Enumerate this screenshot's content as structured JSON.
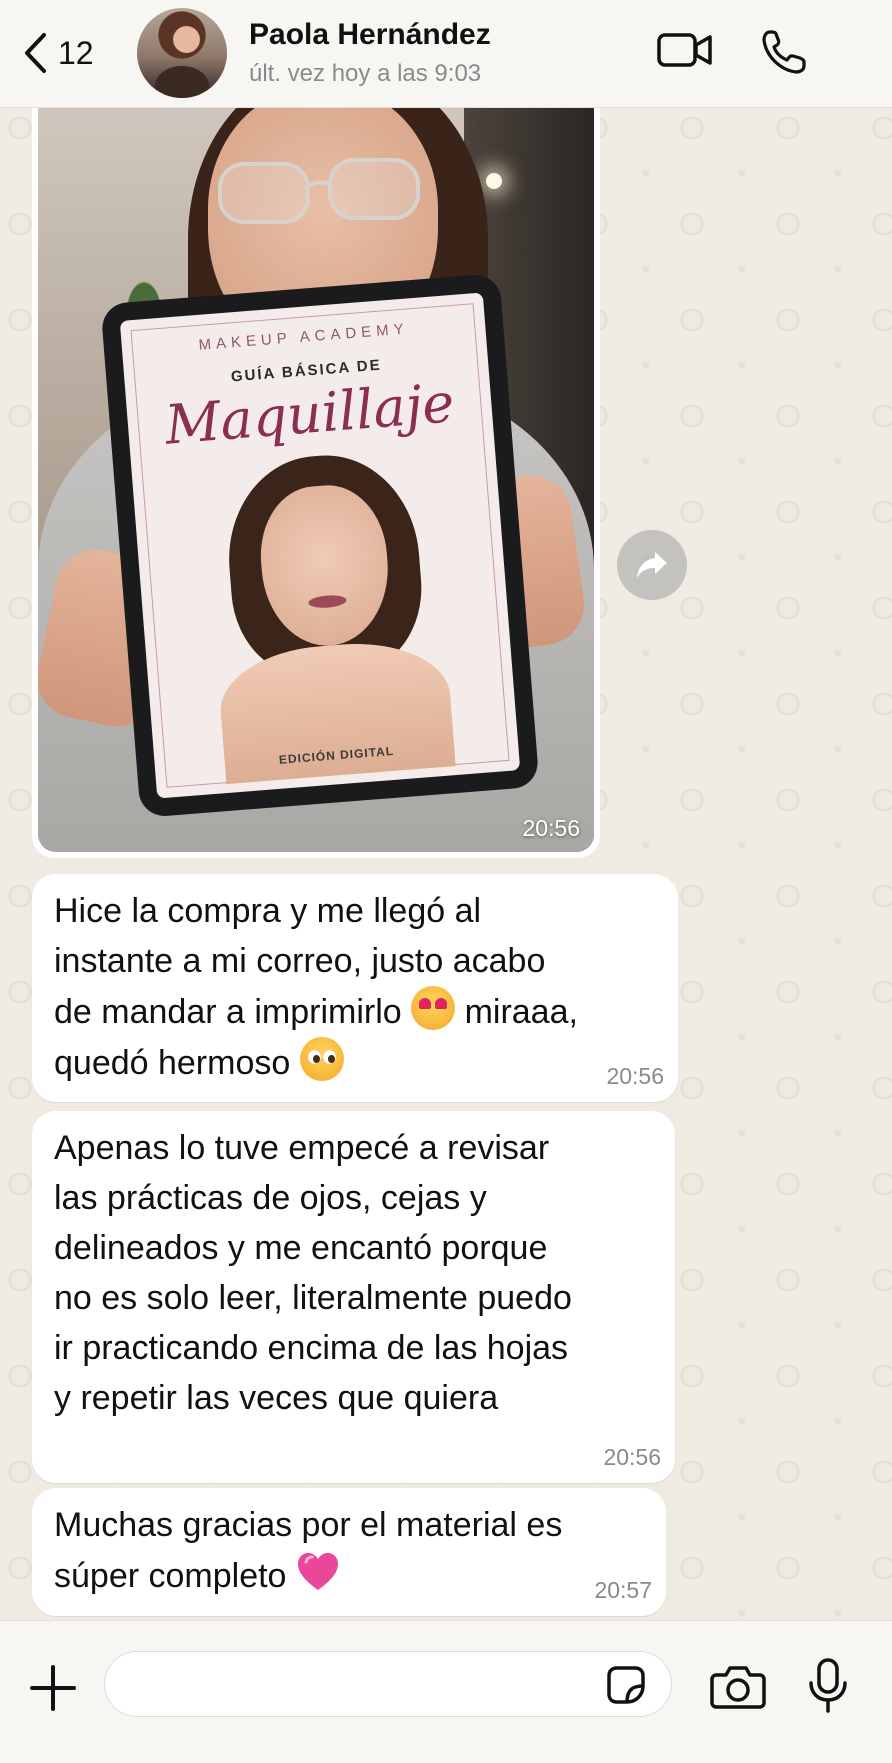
{
  "header": {
    "back_count": "12",
    "contact_name": "Paola Hernández",
    "last_seen": "últ. vez hoy a las 9:03"
  },
  "photo_message": {
    "time": "20:56",
    "cover": {
      "academy": "MAKEUP ACADEMY",
      "subtitle": "GUÍA BÁSICA DE",
      "title": "Maquillaje",
      "edition": "EDICIÓN DIGITAL"
    }
  },
  "messages": [
    {
      "time": "20:56",
      "lines": [
        "Hice la compra y me llegó al",
        "instante a mi correo, justo acabo",
        "de mandar a imprimirlo",
        "miraaa,",
        "quedó hermoso"
      ]
    },
    {
      "time": "20:56",
      "lines": [
        "Apenas lo tuve empecé a revisar",
        "las prácticas de ojos, cejas y",
        "delineados y me encantó porque",
        "no es solo leer, literalmente puedo",
        "ir practicando encima de las hojas",
        "y repetir las veces que quiera"
      ]
    },
    {
      "time": "20:57",
      "lines": [
        "Muchas gracias por el material es",
        "súper completo"
      ]
    }
  ],
  "emojis": [
    "smiling-face-with-heart-eyes",
    "pleading-face",
    "pink-heart"
  ],
  "colors": {
    "chat_background": "#efeae2",
    "bubble": "#ffffff",
    "timestamp": "#8a8a8a",
    "cover_title": "#8b2e4f"
  }
}
